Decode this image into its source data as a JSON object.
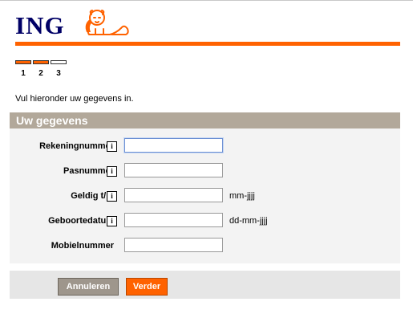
{
  "brand": {
    "name": "ING",
    "accent": "#ff6200",
    "navy": "#000066"
  },
  "steps": {
    "labels": [
      "1",
      "2",
      "3"
    ],
    "current": 2,
    "total": 3
  },
  "intro_text": "Vul hieronder uw gegevens in.",
  "form": {
    "title": "Uw gegevens",
    "info_glyph": "i",
    "fields": {
      "rekeningnummer": {
        "label": "Rekeningnummer",
        "value": "",
        "hint": ""
      },
      "pasnummer": {
        "label": "Pasnummer",
        "value": "",
        "hint": ""
      },
      "geldig": {
        "label": "Geldig t/m",
        "value": "",
        "hint": "mm-jjjj"
      },
      "geboortedatum": {
        "label": "Geboortedatum",
        "value": "",
        "hint": "dd-mm-jjjj"
      },
      "mobielnummer": {
        "label": "Mobielnummer",
        "value": "",
        "hint": ""
      }
    }
  },
  "buttons": {
    "cancel": "Annuleren",
    "next": "Verder"
  }
}
